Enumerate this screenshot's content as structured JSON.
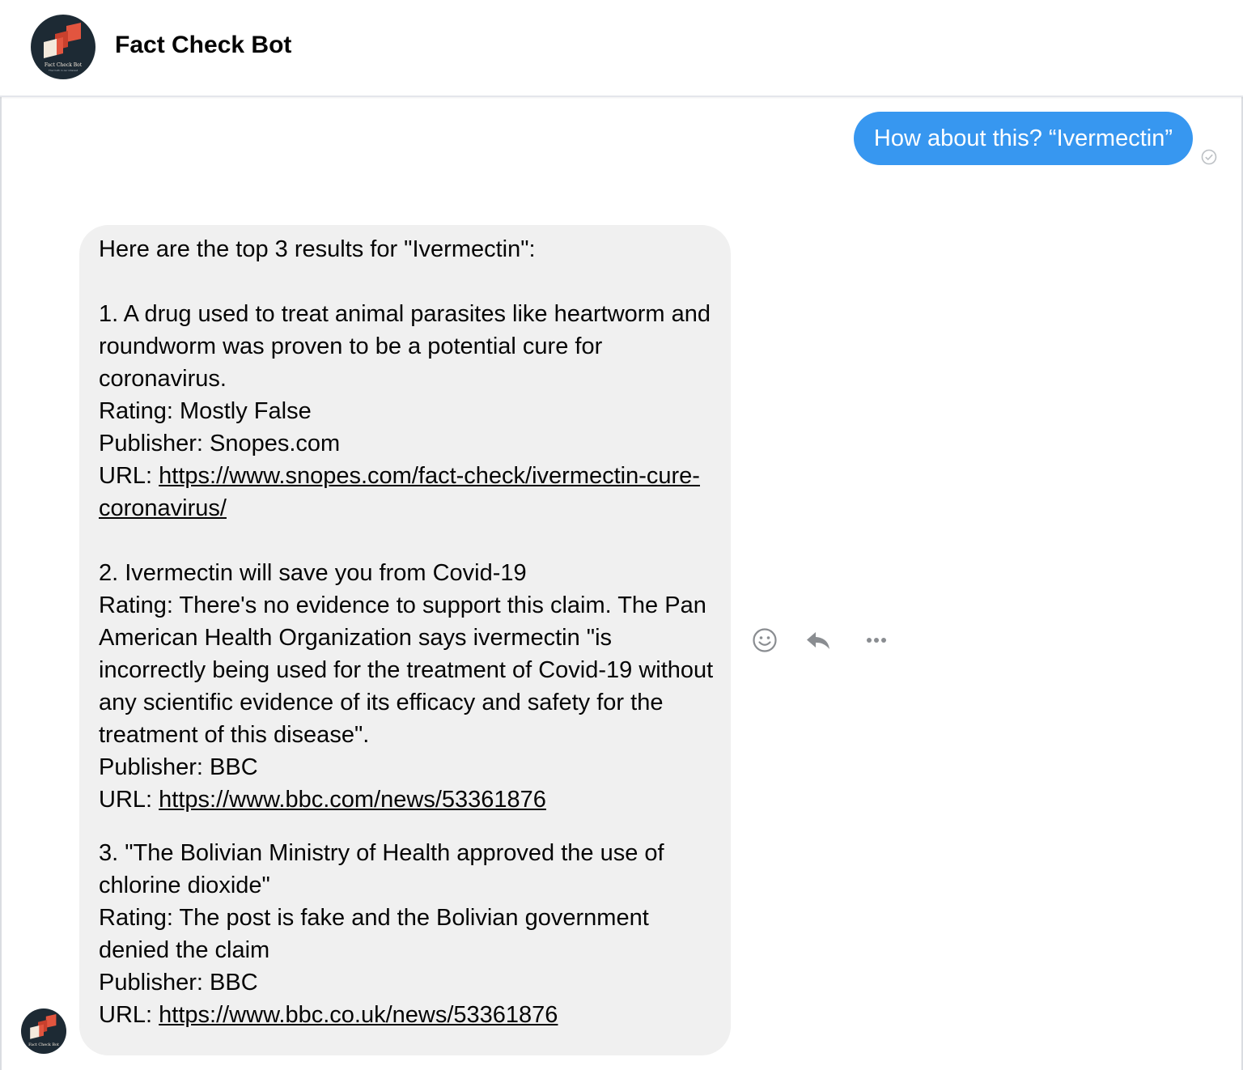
{
  "header": {
    "title": "Fact Check Bot"
  },
  "avatar": {
    "logo_text": "Fact Check Bot",
    "tagline": "The truth in our interest"
  },
  "messages": {
    "user": {
      "text": "How about this? “Ivermectin”",
      "status_icon": "sent-check-icon"
    },
    "bot": {
      "intro": "Here are the top 3 results for \"Ivermectin\":",
      "results": [
        {
          "claim": "1. A drug used to treat animal parasites like heartworm and roundworm was proven to be a potential cure for coronavirus.",
          "rating": "Rating: Mostly False",
          "publisher": "Publisher: Snopes.com",
          "url_label": "URL: ",
          "url": "https://www.snopes.com/fact-check/ivermectin-cure-coronavirus/"
        },
        {
          "claim": "2. Ivermectin will save you from Covid-19",
          "rating": "Rating: There's no evidence to support this claim. The Pan American Health Organization says ivermectin \"is incorrectly being used for the treatment of Covid-19 without any scientific evidence of its efficacy and safety for the treatment of this disease\".",
          "publisher": "Publisher: BBC",
          "url_label": "URL: ",
          "url": "https://www.bbc.com/news/53361876"
        },
        {
          "claim": "3. \"The Bolivian Ministry of Health approved the use of chlorine dioxide\"",
          "rating": "Rating: The post is fake and the Bolivian government denied the claim",
          "publisher": "Publisher: BBC",
          "url_label": "URL: ",
          "url": "https://www.bbc.co.uk/news/53361876"
        }
      ]
    }
  },
  "actions": [
    "emoji-icon",
    "reply-icon",
    "more-icon"
  ],
  "colors": {
    "user_bubble": "#3797f0",
    "bot_bubble": "#f0f0f0",
    "avatar_bg": "#1d2a34",
    "logo_accent": "#e2553f",
    "logo_light": "#f3e9dc"
  }
}
